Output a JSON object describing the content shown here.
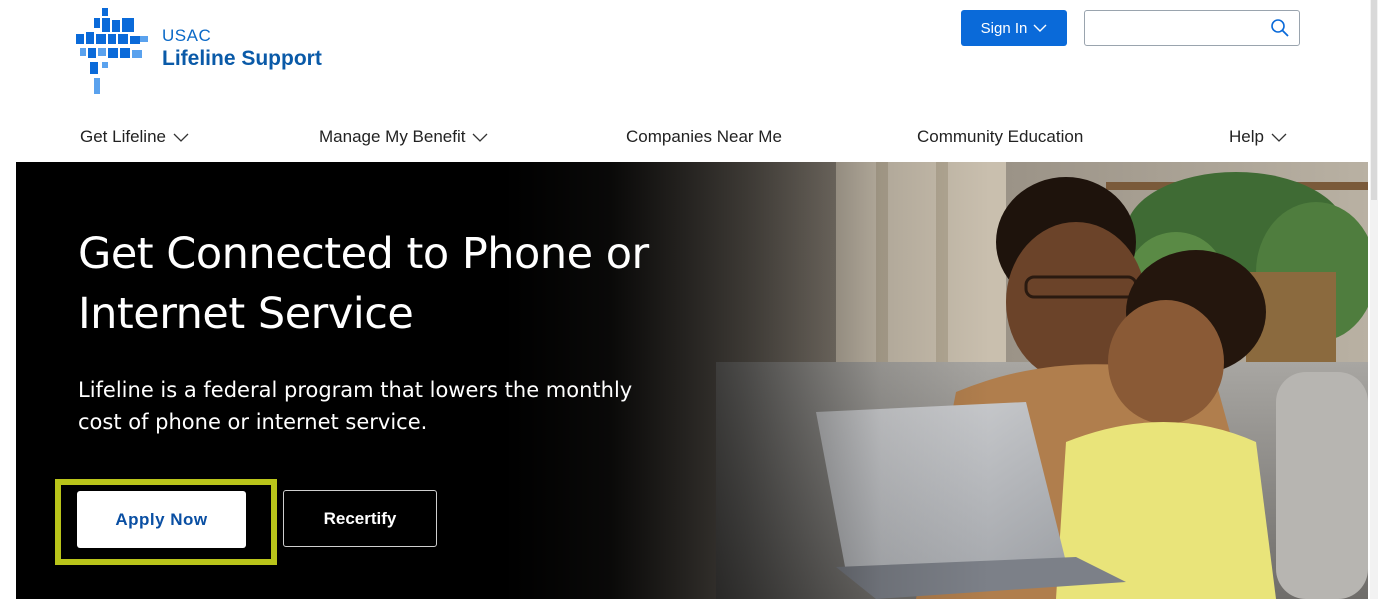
{
  "header": {
    "logo_top": "USAC",
    "logo_name": "Lifeline Support",
    "signin_label": "Sign In",
    "search_value": ""
  },
  "nav": {
    "items": [
      {
        "label": "Get Lifeline",
        "has_dropdown": true
      },
      {
        "label": "Manage My Benefit",
        "has_dropdown": true
      },
      {
        "label": "Companies Near Me",
        "has_dropdown": false
      },
      {
        "label": "Community Education",
        "has_dropdown": false
      },
      {
        "label": "Help",
        "has_dropdown": true
      }
    ]
  },
  "hero": {
    "title": "Get Connected to Phone or Internet Service",
    "subtitle": "Lifeline is a federal program that lowers the monthly cost of phone or internet service.",
    "apply_label": "Apply Now",
    "recertify_label": "Recertify"
  },
  "colors": {
    "brand_blue": "#0a6ad9",
    "logo_blue": "#0a5aa8",
    "highlight": "#b9c41a"
  },
  "icons": {
    "search": "search-icon",
    "dropdown": "chevron-down-icon"
  }
}
